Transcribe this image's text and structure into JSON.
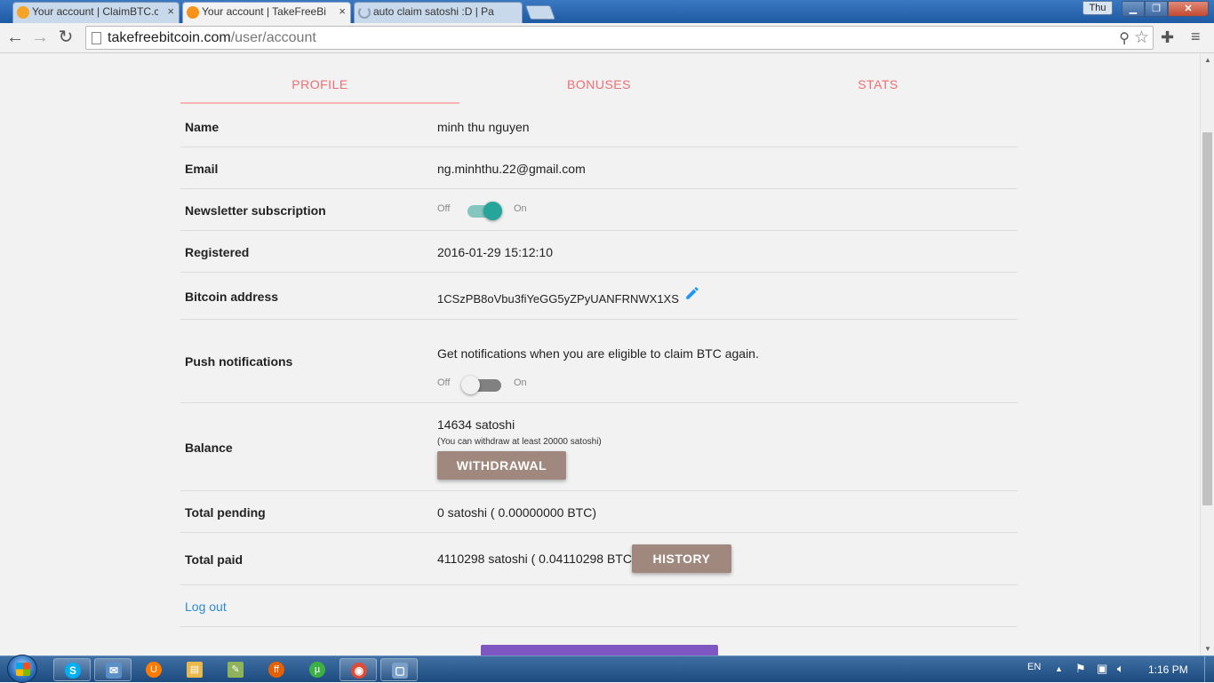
{
  "browser": {
    "tabs": [
      {
        "title": "Your account | ClaimBTC.c",
        "favicon_color": "#f7a325",
        "active": false
      },
      {
        "title": "Your account | TakeFreeBi",
        "favicon_color": "#f7931a",
        "active": true
      },
      {
        "title": "auto claim satoshi :D | Pa",
        "favicon_color": "#8aa0b8",
        "active": false
      }
    ],
    "close_glyph": "×",
    "window_user": "Thu",
    "url_host": "takefreebitcoin.com",
    "url_path": "/user/account"
  },
  "page": {
    "tabs": [
      "PROFILE",
      "BONUSES",
      "STATS"
    ],
    "active_tab": "PROFILE",
    "accent": "#ee6e73",
    "rows": {
      "name": {
        "label": "Name",
        "value": "minh thu nguyen"
      },
      "email": {
        "label": "Email",
        "value": "ng.minhthu.22@gmail.com"
      },
      "newsletter": {
        "label": "Newsletter subscription",
        "off": "Off",
        "on": "On",
        "state": "on"
      },
      "registered": {
        "label": "Registered",
        "value": "2016-01-29 15:12:10"
      },
      "bitcoin": {
        "label": "Bitcoin address",
        "value": "1CSzPB8oVbu3fiYeGG5yZPyUANFRNWX1XS"
      },
      "push": {
        "label": "Push notifications",
        "description": "Get notifications when you are eligible to claim BTC again.",
        "off": "Off",
        "on": "On",
        "state": "off"
      },
      "balance": {
        "label": "Balance",
        "value": "14634 satoshi",
        "note": "(You can withdraw at least 20000 satoshi)",
        "button": "WITHDRAWAL"
      },
      "pending": {
        "label": "Total pending",
        "value": "0 satoshi ( 0.00000000 BTC)"
      },
      "paid": {
        "label": "Total paid",
        "value": "4110298 satoshi ( 0.04110298 BTC)",
        "button": "HISTORY"
      }
    },
    "logout": "Log out"
  },
  "taskbar": {
    "items": [
      {
        "name": "skype",
        "label": "S",
        "color": "#00aff0"
      },
      {
        "name": "app-bird",
        "label": "✉",
        "color": "#5b8fc7"
      },
      {
        "name": "uc-browser",
        "label": "U",
        "color": "#ff7a00"
      },
      {
        "name": "file-explorer",
        "label": "▤",
        "color": "#e8b84a"
      },
      {
        "name": "notepad",
        "label": "✎",
        "color": "#8fb35a"
      },
      {
        "name": "firefox",
        "label": "ff",
        "color": "#e66000"
      },
      {
        "name": "utorrent",
        "label": "µ",
        "color": "#3cb043"
      },
      {
        "name": "chrome",
        "label": "◉",
        "color": "#dd4b39"
      },
      {
        "name": "window-app",
        "label": "▢",
        "color": "#7aa0c8"
      }
    ],
    "language": "EN",
    "clock": "1:16 PM"
  }
}
